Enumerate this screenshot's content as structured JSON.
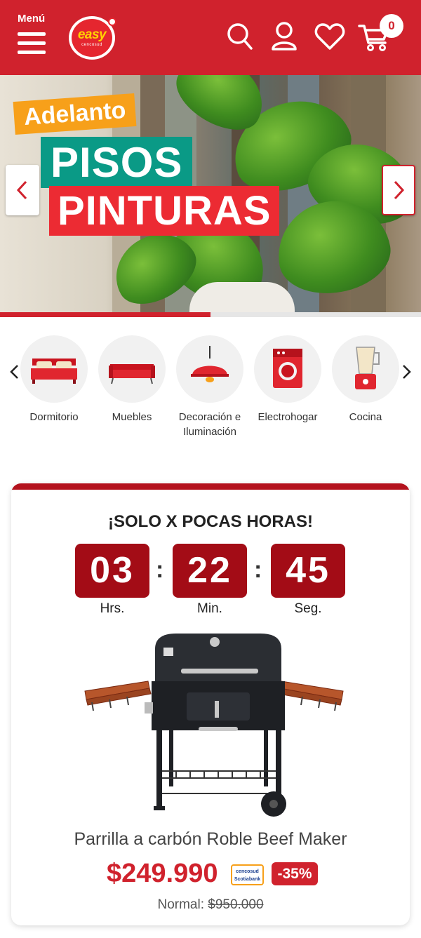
{
  "header": {
    "menu_label": "Menú",
    "logo_text": "easy",
    "logo_sub": "cencosud",
    "cart_count": "0",
    "brand_color": "#d0222d",
    "icons": [
      "menu-icon",
      "search-icon",
      "user-icon",
      "heart-icon",
      "cart-icon"
    ]
  },
  "banner": {
    "line1": "Adelanto",
    "line2": "PISOS",
    "line3": "PINTURAS",
    "progress": 0.5
  },
  "categories": [
    {
      "label": "Dormitorio",
      "icon": "bed-icon"
    },
    {
      "label": "Muebles",
      "icon": "sofa-icon"
    },
    {
      "label": "Decoración e Iluminación",
      "icon": "lamp-icon"
    },
    {
      "label": "Electrohogar",
      "icon": "washing-machine-icon"
    },
    {
      "label": "Cocina",
      "icon": "blender-icon"
    }
  ],
  "deal": {
    "title": "¡SOLO X POCAS HORAS!",
    "hours": "03",
    "minutes": "22",
    "seconds": "45",
    "hours_label": "Hrs.",
    "minutes_label": "Min.",
    "seconds_label": "Seg.",
    "separator": ":",
    "product_name": "Parrilla a carbón Roble Beef Maker",
    "price": "$249.990",
    "card_badge_line1": "cencosud",
    "card_badge_line2": "Scotiabank",
    "discount": "-35%",
    "normal_label": "Normal:",
    "normal_price": "$950.000"
  }
}
